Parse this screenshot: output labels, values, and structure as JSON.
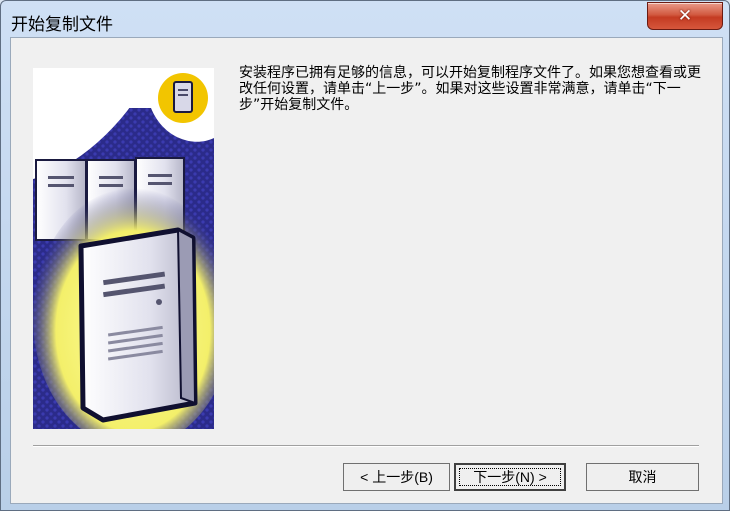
{
  "window": {
    "title": "开始复制文件",
    "close_glyph": "✕"
  },
  "message": {
    "text": "安装程序已拥有足够的信息，可以开始复制程序文件了。如果您想查看或更改任何设置，请单击“上一步”。如果对这些设置非常满意，请单击“下一步”开始复制文件。"
  },
  "buttons": {
    "back": "< 上一步(B)",
    "next": "下一步(N) >",
    "cancel": "取消"
  },
  "colors": {
    "art_background": "#2b2b8a",
    "badge": "#f2c500",
    "glow": "#f7f37a",
    "close_red": "#c43b22"
  },
  "icons": {
    "close": "close-icon",
    "art": "servers-illustration",
    "badge": "computer-tower-badge-icon"
  }
}
